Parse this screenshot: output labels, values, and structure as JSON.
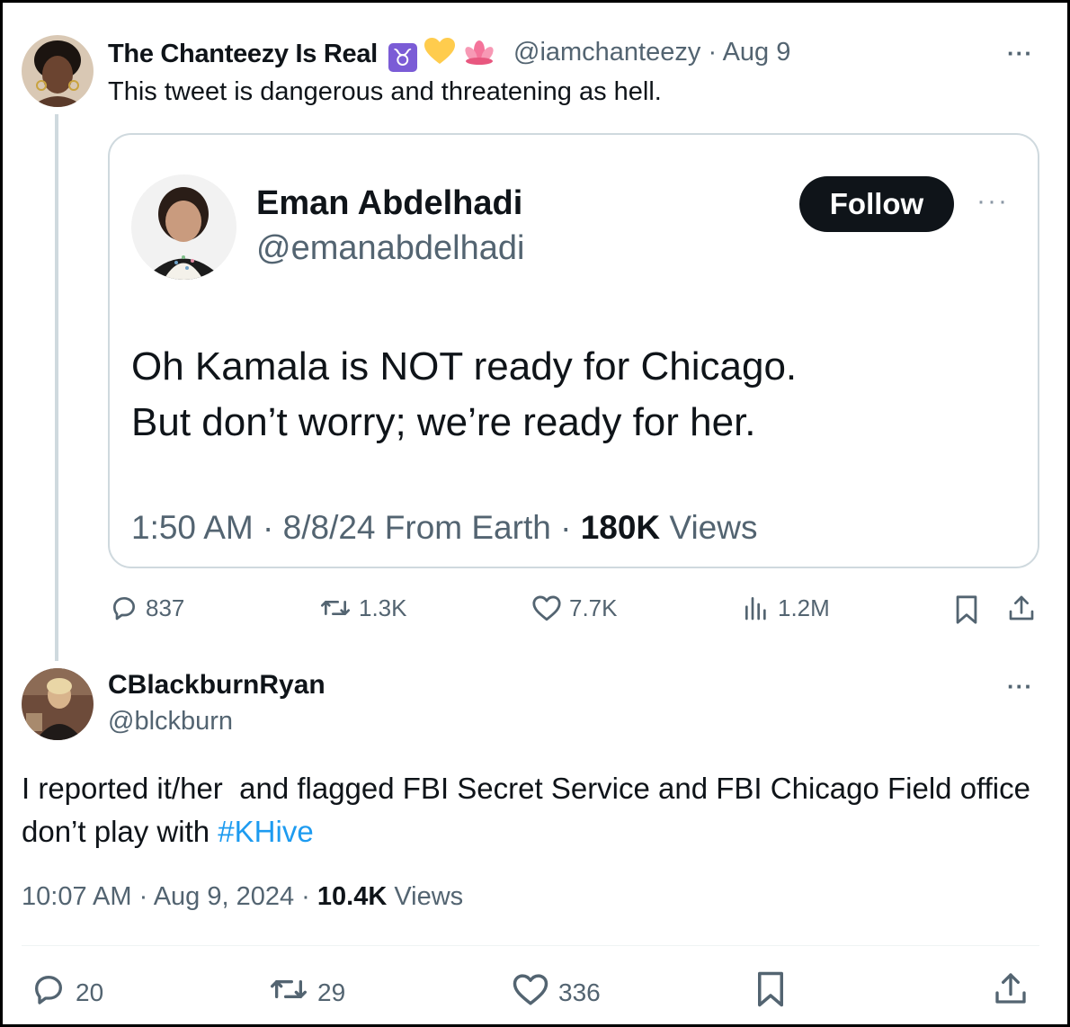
{
  "tweet": {
    "author_name": "The Chanteezy Is Real",
    "author_emojis": "♉💛🪷",
    "author_handle": "@iamchanteezy",
    "separator": "·",
    "date": "Aug 9",
    "text": "This tweet is dangerous and threatening as hell.",
    "more_label": "···",
    "quote": {
      "author_name": "Eman Abdelhadi",
      "author_handle": "@emanabdelhadi",
      "follow_label": "Follow",
      "more_label": "···",
      "text_line1": "Oh Kamala is NOT ready for Chicago.",
      "text_line2": "But don’t worry; we’re ready for her.",
      "meta_prefix": "1:50 AM · 8/8/24 From Earth · ",
      "views_count": "180K",
      "views_label": " Views"
    },
    "actions": {
      "replies": "837",
      "reposts": "1.3K",
      "likes": "7.7K",
      "views": "1.2M"
    }
  },
  "reply": {
    "author_name": "CBlackburnRyan",
    "author_handle": "@blckburn",
    "more_label": "···",
    "text": "I reported it/her  and flagged FBI Secret Service and FBI Chicago Field office don’t play with ",
    "hashtag": "#KHive",
    "meta_prefix": "10:07 AM · Aug 9, 2024 · ",
    "views_count": "10.4K",
    "views_label": " Views",
    "actions": {
      "replies": "20",
      "reposts": "29",
      "likes": "336"
    }
  },
  "colors": {
    "text": "#0f1419",
    "secondary": "#536471",
    "link": "#1d9bf0",
    "border": "#cfd9de",
    "taurus_purple": "#7b5cd6",
    "yellow_heart": "#ffcc4d",
    "lotus_pink": "#f4739a"
  },
  "icons": [
    "reply-icon",
    "repost-icon",
    "like-icon",
    "views-icon",
    "bookmark-icon",
    "share-icon",
    "more-icon"
  ]
}
